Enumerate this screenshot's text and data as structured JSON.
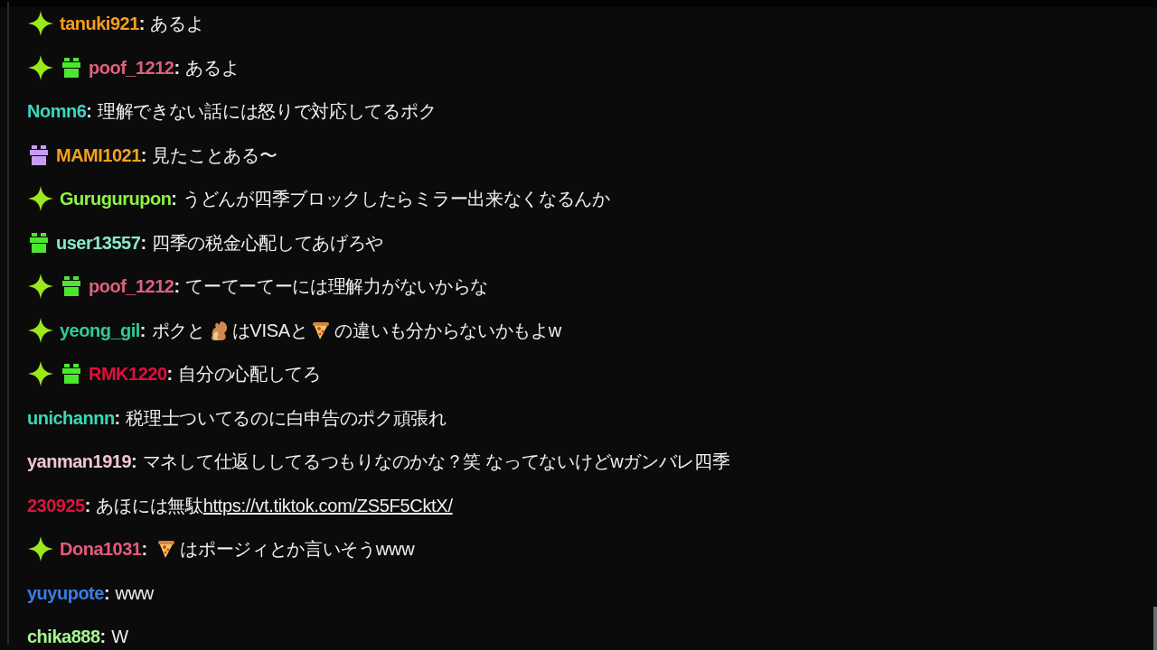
{
  "messages": [
    {
      "badges": [
        {
          "kind": "sparkle"
        }
      ],
      "user": "tanuki921",
      "color": "#f59e1b",
      "sep": ":",
      "parts": [
        {
          "kind": "text",
          "text": "あるよ"
        }
      ]
    },
    {
      "badges": [
        {
          "kind": "sparkle"
        },
        {
          "kind": "gift",
          "color": "#4ce62e"
        }
      ],
      "user": "poof_1212",
      "color": "#e0607e",
      "sep": ":",
      "parts": [
        {
          "kind": "text",
          "text": "あるよ"
        }
      ]
    },
    {
      "user": "Nomn6",
      "color": "#3dd6c0",
      "sep": ":",
      "parts": [
        {
          "kind": "text",
          "text": "理解できない話には怒りで対応してるポク"
        }
      ]
    },
    {
      "badges": [
        {
          "kind": "gift",
          "color": "#c89cf0"
        }
      ],
      "user": "MAMI1021",
      "color": "#f5a01f",
      "sep": ":",
      "parts": [
        {
          "kind": "text",
          "text": "見たことある〜"
        }
      ]
    },
    {
      "badges": [
        {
          "kind": "sparkle"
        }
      ],
      "user": "Gurugurupon",
      "color": "#8cf542",
      "sep": ":",
      "parts": [
        {
          "kind": "text",
          "text": "うどんが四季ブロックしたらミラー出来なくなるんか"
        }
      ]
    },
    {
      "badges": [
        {
          "kind": "gift",
          "color": "#4ce62e"
        }
      ],
      "user": "user13557",
      "color": "#8ae8cc",
      "sep": ":",
      "parts": [
        {
          "kind": "text",
          "text": "四季の税金心配してあげろや"
        }
      ]
    },
    {
      "badges": [
        {
          "kind": "sparkle"
        },
        {
          "kind": "gift",
          "color": "#4ce62e"
        }
      ],
      "user": "poof_1212",
      "color": "#e0607e",
      "sep": ":",
      "parts": [
        {
          "kind": "text",
          "text": "てーてーてーには理解力がないからな"
        }
      ]
    },
    {
      "badges": [
        {
          "kind": "sparkle"
        }
      ],
      "user": "yeong_gil",
      "color": "#2ecc9a",
      "sep": ":",
      "parts": [
        {
          "kind": "text",
          "text": "ポクと"
        },
        {
          "kind": "squirrel"
        },
        {
          "kind": "text",
          "text": "はVISAと"
        },
        {
          "kind": "pizza"
        },
        {
          "kind": "text",
          "text": "の違いも分からないかもよw"
        }
      ]
    },
    {
      "badges": [
        {
          "kind": "sparkle"
        },
        {
          "kind": "gift",
          "color": "#4ce62e"
        }
      ],
      "user": "RMK1220",
      "color": "#e0103c",
      "sep": ":",
      "parts": [
        {
          "kind": "text",
          "text": "自分の心配してろ"
        }
      ]
    },
    {
      "user": "unichannn",
      "color": "#3dd6b5",
      "sep": ":",
      "parts": [
        {
          "kind": "text",
          "text": "税理士ついてるのに白申告のポク頑張れ"
        }
      ]
    },
    {
      "user": "yanman1919",
      "color": "#f2c4d4",
      "sep": ":",
      "parts": [
        {
          "kind": "text",
          "text": "マネして仕返ししてるつもりなのかな？笑 なってないけどwガンバレ四季"
        }
      ]
    },
    {
      "user": "230925",
      "color": "#d8163c",
      "sep": ":",
      "parts": [
        {
          "kind": "text",
          "text": "あほには無駄"
        },
        {
          "kind": "link",
          "text": "https://vt.tiktok.com/ZS5F5CktX/"
        }
      ]
    },
    {
      "badges": [
        {
          "kind": "sparkle"
        }
      ],
      "user": "Dona1031",
      "color": "#e85a7a",
      "sep": ":",
      "parts": [
        {
          "kind": "pizza"
        },
        {
          "kind": "text",
          "text": "はポージィとか言いそうwww"
        }
      ]
    },
    {
      "user": "yuyupote",
      "color": "#3a7ee8",
      "sep": ":",
      "parts": [
        {
          "kind": "text",
          "text": "www"
        }
      ]
    },
    {
      "user": "chika888",
      "color": "#a6f590",
      "sep": ":",
      "parts": [
        {
          "kind": "text",
          "text": "W"
        }
      ]
    }
  ]
}
